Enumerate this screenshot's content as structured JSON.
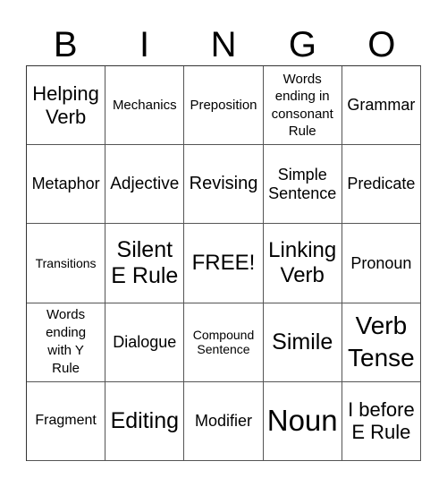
{
  "header": [
    "B",
    "I",
    "N",
    "G",
    "O"
  ],
  "cells": [
    [
      "Helping Verb",
      "Mechanics",
      "Preposition",
      "Words ending in consonant Rule",
      "Grammar"
    ],
    [
      "Metaphor",
      "Adjective",
      "Revising",
      "Simple Sentence",
      "Predicate"
    ],
    [
      "Transitions",
      "Silent E Rule",
      "FREE!",
      "Linking Verb",
      "Pronoun"
    ],
    [
      "Words ending with Y Rule",
      "Dialogue",
      "Compound Sentence",
      "Simile",
      "Verb Tense"
    ],
    [
      "Fragment",
      "Editing",
      "Modifier",
      "Noun",
      "I before E Rule"
    ]
  ]
}
